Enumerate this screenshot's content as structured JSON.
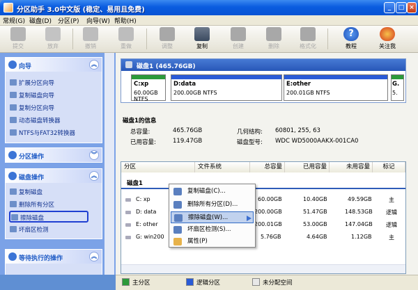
{
  "window": {
    "title": "分区助手 3.0中文版 (稳定、易用且免费)"
  },
  "menu": [
    "常规(G)",
    "磁盘(D)",
    "分区(P)",
    "向导(W)",
    "帮助(H)"
  ],
  "toolbar": [
    {
      "label": "提交",
      "icon": "check-icon",
      "enabled": false
    },
    {
      "label": "放弃",
      "icon": "x-icon",
      "enabled": false
    },
    {
      "label": "撤销",
      "icon": "undo-icon",
      "enabled": false
    },
    {
      "label": "重做",
      "icon": "redo-icon",
      "enabled": false
    },
    {
      "label": "调整",
      "icon": "resize-disk-icon",
      "enabled": false
    },
    {
      "label": "复制",
      "icon": "copy-disk-icon",
      "enabled": true
    },
    {
      "label": "创建",
      "icon": "create-disk-icon",
      "enabled": false
    },
    {
      "label": "删除",
      "icon": "delete-disk-icon",
      "enabled": false
    },
    {
      "label": "格式化",
      "icon": "format-disk-icon",
      "enabled": false
    },
    {
      "label": "教程",
      "icon": "help-icon",
      "enabled": true
    },
    {
      "label": "关注我",
      "icon": "weibo-icon",
      "enabled": true
    }
  ],
  "panels": {
    "wizard": {
      "title": "向导",
      "items": [
        "扩展分区向导",
        "复制磁盘向导",
        "复制分区向导",
        "动态磁盘转换器",
        "NTFS与FAT32转换器"
      ]
    },
    "partition_ops": {
      "title": "分区操作"
    },
    "disk_ops": {
      "title": "磁盘操作",
      "items": [
        "复制磁盘",
        "删除所有分区",
        "擦除磁盘",
        "坏扇区检测"
      ]
    },
    "pending": {
      "title": "等待执行的操作"
    }
  },
  "disk": {
    "header": "磁盘1 (465.76GB)",
    "partitions": [
      {
        "name": "C:xp",
        "size": "60.00GB NTFS"
      },
      {
        "name": "D:data",
        "size": "200.00GB NTFS"
      },
      {
        "name": "E:other",
        "size": "200.01GB NTFS"
      },
      {
        "name": "G.",
        "size": "5."
      }
    ]
  },
  "info": {
    "title": "磁盘1的信息",
    "total_label": "总容量:",
    "total": "465.76GB",
    "used_label": "已用容量:",
    "used": "119.47GB",
    "geometry_label": "几何结构:",
    "geometry": "60801, 255, 63",
    "model_label": "磁盘型号:",
    "model": "WDC WD5000AAKX-001CA0"
  },
  "table": {
    "headers": [
      "分区",
      "文件系统",
      "总容量",
      "已用容量",
      "未用容量",
      "标记"
    ],
    "group": "磁盘1",
    "rows": [
      {
        "part": "C: xp",
        "total": "60.00GB",
        "used": "10.40GB",
        "free": "49.59GB",
        "flag": "主"
      },
      {
        "part": "D: data",
        "total": "200.00GB",
        "used": "51.47GB",
        "free": "148.53GB",
        "flag": "逻辑"
      },
      {
        "part": "E: other",
        "total": "200.01GB",
        "used": "53.00GB",
        "free": "147.04GB",
        "flag": "逻辑"
      },
      {
        "part": "G: win200",
        "total": "5.76GB",
        "used": "4.64GB",
        "free": "1.12GB",
        "flag": "主"
      }
    ]
  },
  "context_menu": [
    "复制磁盘(C)...",
    "删除所有分区(D)...",
    "擦除磁盘(W)...",
    "坏扇区检测(S)...",
    "属性(P)"
  ],
  "legend": [
    {
      "label": "主分区",
      "color": "#2c9a3a"
    },
    {
      "label": "逻辑分区",
      "color": "#2a5bd7"
    },
    {
      "label": "未分配空间",
      "color": "#e8e8e8"
    }
  ]
}
